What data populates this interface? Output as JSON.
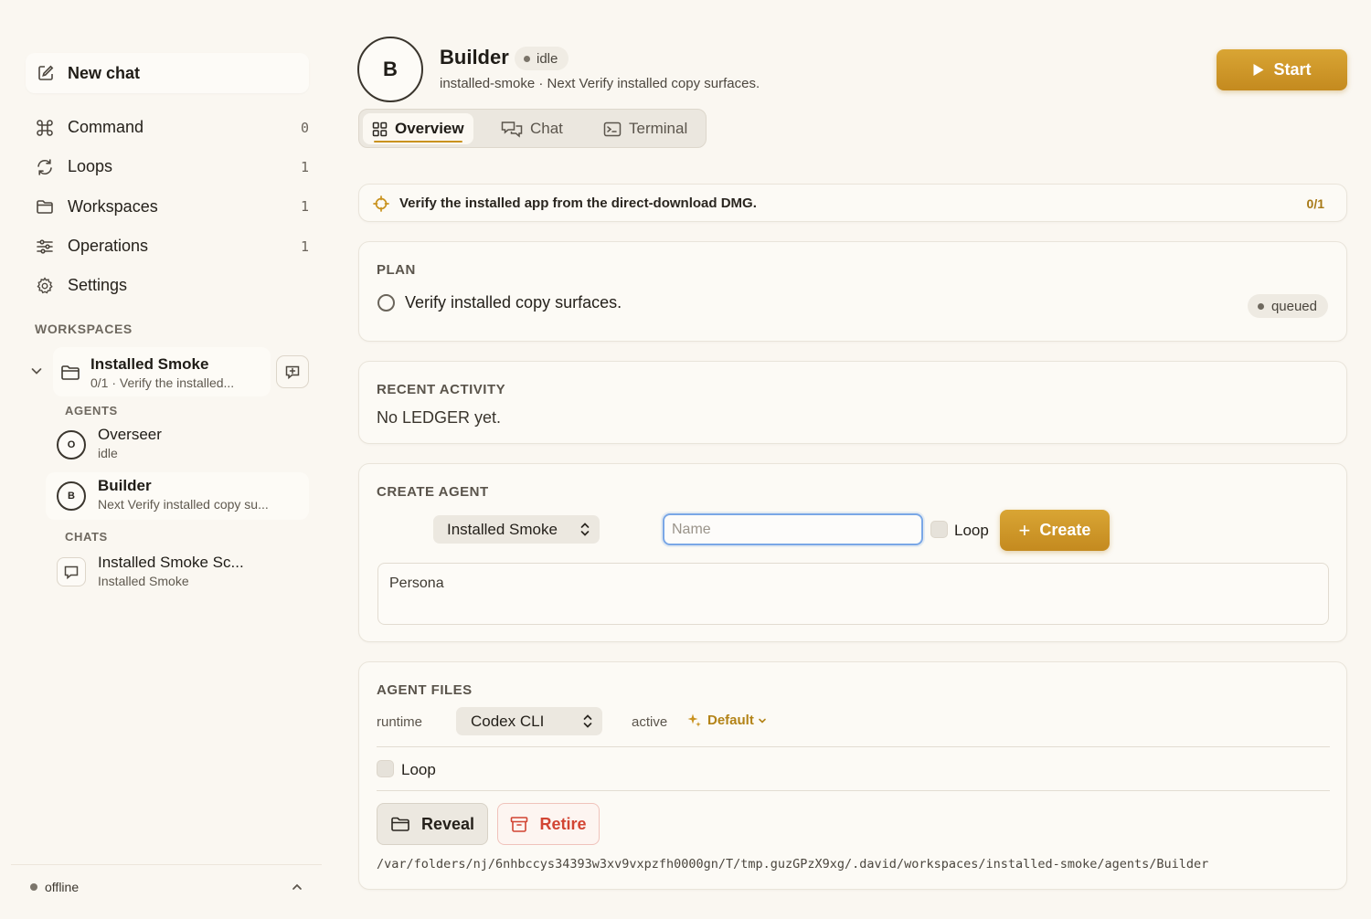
{
  "sidebar": {
    "new_chat": "New chat",
    "nav": [
      {
        "label": "Command",
        "count": "0",
        "icon": "command-icon"
      },
      {
        "label": "Loops",
        "count": "1",
        "icon": "refresh-icon"
      },
      {
        "label": "Workspaces",
        "count": "1",
        "icon": "folder-icon"
      },
      {
        "label": "Operations",
        "count": "1",
        "icon": "sliders-icon"
      },
      {
        "label": "Settings",
        "count": "",
        "icon": "gear-icon"
      }
    ],
    "workspaces_title": "WORKSPACES",
    "workspace": {
      "name": "Installed Smoke",
      "summary": "0/1 · Verify the installed..."
    },
    "agents_title": "AGENTS",
    "agents": [
      {
        "initial": "O",
        "name": "Overseer",
        "status": "idle"
      },
      {
        "initial": "B",
        "name": "Builder",
        "status": "Next Verify installed copy su..."
      }
    ],
    "chats_title": "CHATS",
    "chat": {
      "name": "Installed Smoke Sc...",
      "workspace": "Installed Smoke"
    },
    "connection_status": "offline"
  },
  "header": {
    "avatar_initial": "B",
    "agent_name": "Builder",
    "status": "idle",
    "subtitle": "installed-smoke · Next Verify installed copy surfaces.",
    "start_label": "Start"
  },
  "tabs": [
    {
      "label": "Overview",
      "active": true
    },
    {
      "label": "Chat",
      "active": false
    },
    {
      "label": "Terminal",
      "active": false
    }
  ],
  "goal": {
    "text": "Verify the installed app from the direct-download DMG.",
    "progress": "0/1"
  },
  "plan": {
    "title": "PLAN",
    "item": "Verify installed copy surfaces.",
    "item_status": "queued"
  },
  "activity": {
    "title": "RECENT ACTIVITY",
    "empty_text": "No LEDGER yet."
  },
  "create_agent": {
    "title": "CREATE AGENT",
    "workspace_selected": "Installed Smoke",
    "name_placeholder": "Name",
    "loop_label": "Loop",
    "create_label": "Create",
    "persona_placeholder": "Persona"
  },
  "agent_files": {
    "title": "AGENT FILES",
    "runtime_label": "runtime",
    "runtime_selected": "Codex CLI",
    "active_label": "active",
    "active_value": "Default",
    "loop_label": "Loop",
    "reveal_label": "Reveal",
    "retire_label": "Retire",
    "path": "/var/folders/nj/6nhbccys34393w3xv9vxpzfh0000gn/T/tmp.guzGPzX9xg/.david/workspaces/installed-smoke/agents/Builder"
  },
  "colors": {
    "accent": "#c9921f",
    "danger": "#d24533",
    "focus": "#7aa7e6"
  }
}
